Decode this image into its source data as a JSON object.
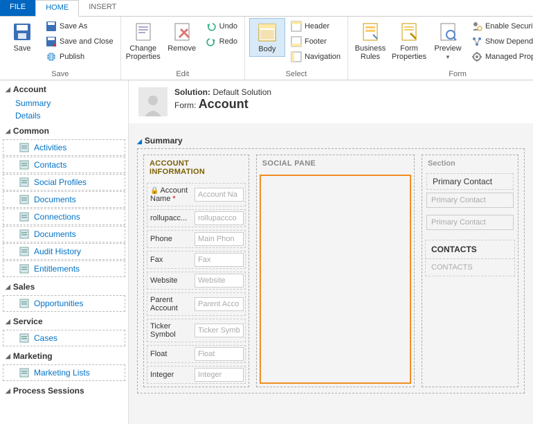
{
  "tabs": {
    "file": "FILE",
    "home": "HOME",
    "insert": "INSERT"
  },
  "ribbon": {
    "save": {
      "save": "Save",
      "save_as": "Save As",
      "save_close": "Save and Close",
      "publish": "Publish",
      "group": "Save"
    },
    "edit": {
      "change_props": "Change Properties",
      "remove": "Remove",
      "undo": "Undo",
      "redo": "Redo",
      "group": "Edit"
    },
    "select": {
      "body": "Body",
      "header": "Header",
      "footer": "Footer",
      "navigation": "Navigation",
      "group": "Select"
    },
    "form": {
      "biz_rules": "Business Rules",
      "form_props": "Form Properties",
      "preview": "Preview",
      "sec_roles": "Enable Security Roles",
      "deps": "Show Dependencies",
      "managed": "Managed Properties",
      "group": "Form"
    }
  },
  "sidebar": {
    "account": {
      "title": "Account",
      "items": [
        "Summary",
        "Details"
      ]
    },
    "common": {
      "title": "Common",
      "items": [
        "Activities",
        "Contacts",
        "Social Profiles",
        "Documents",
        "Connections",
        "Documents",
        "Audit History",
        "Entitlements"
      ]
    },
    "sales": {
      "title": "Sales",
      "items": [
        "Opportunities"
      ]
    },
    "service": {
      "title": "Service",
      "items": [
        "Cases"
      ]
    },
    "marketing": {
      "title": "Marketing",
      "items": [
        "Marketing Lists"
      ]
    },
    "process": {
      "title": "Process Sessions"
    }
  },
  "header": {
    "solution_label": "Solution:",
    "solution_value": "Default Solution",
    "form_label": "Form:",
    "form_value": "Account"
  },
  "summary": {
    "title": "Summary",
    "col1": {
      "title": "ACCOUNT INFORMATION",
      "fields": [
        {
          "label": "Account Name",
          "placeholder": "Account Na",
          "locked": true,
          "required": true
        },
        {
          "label": "rollupacc...",
          "placeholder": "rollupaccco"
        },
        {
          "label": "Phone",
          "placeholder": "Main Phon"
        },
        {
          "label": "Fax",
          "placeholder": "Fax"
        },
        {
          "label": "Website",
          "placeholder": "Website"
        },
        {
          "label": "Parent Account",
          "placeholder": "Parent Acco"
        },
        {
          "label": "Ticker Symbol",
          "placeholder": "Ticker Symb"
        },
        {
          "label": "Float",
          "placeholder": "Float"
        },
        {
          "label": "Integer",
          "placeholder": "Integer"
        }
      ]
    },
    "col2": {
      "title": "SOCIAL PANE"
    },
    "col3": {
      "section_hdr": "Section",
      "pc_label": "Primary Contact",
      "pc_placeholder": "Primary Contact",
      "pc_placeholder2": "Primary Contact",
      "contacts_title": "CONTACTS",
      "contacts_body": "CONTACTS"
    }
  }
}
